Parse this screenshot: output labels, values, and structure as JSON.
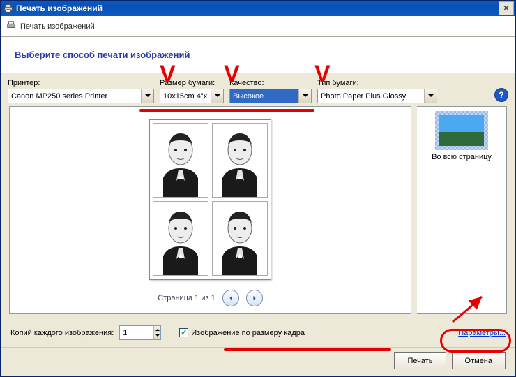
{
  "title": "Печать изображений",
  "subhead": "Печать изображений",
  "heading": "Выберите способ печати изображений",
  "labels": {
    "printer": "Принтер:",
    "paper_size": "Размер бумаги:",
    "quality": "Качество:",
    "paper_type": "Тип бумаги:"
  },
  "values": {
    "printer": "Canon MP250 series Printer",
    "paper_size": "10x15cm 4\"x",
    "quality": "Высокое",
    "paper_type": "Photo Paper Plus Glossy"
  },
  "template_name": "Во всю страницу",
  "pager": "Страница 1 из 1",
  "copies_label": "Копий каждого изображения:",
  "copies_value": "1",
  "fit_label": "Изображение по размеру кадра",
  "params_link": "Параметры...",
  "buttons": {
    "print": "Печать",
    "cancel": "Отмена"
  },
  "help_symbol": "?"
}
